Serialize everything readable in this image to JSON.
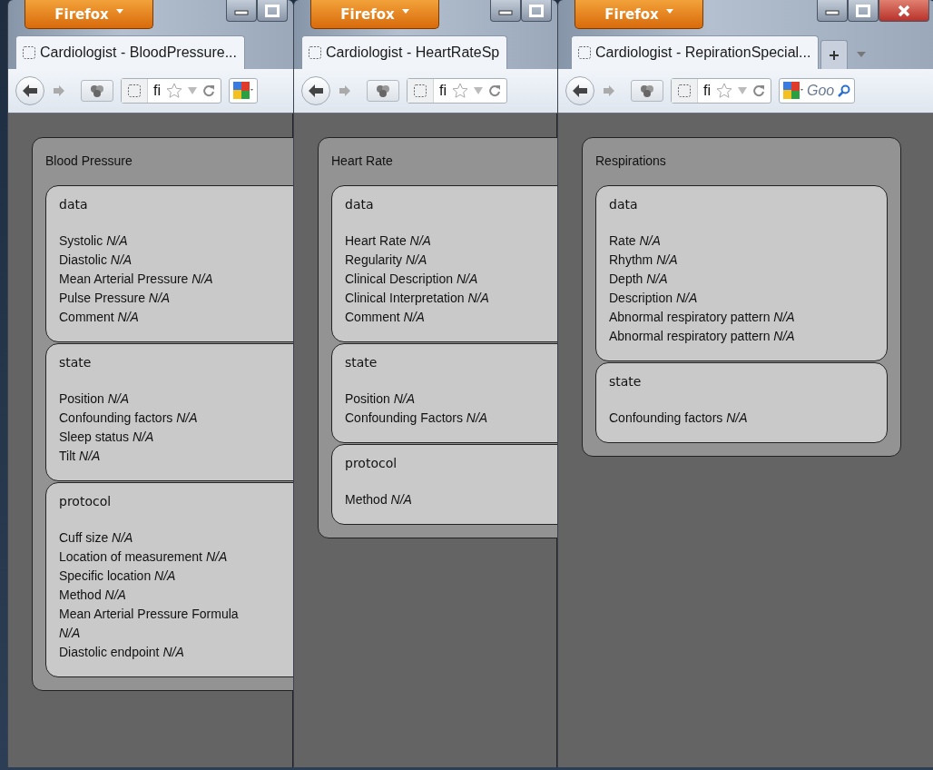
{
  "windows": [
    {
      "app_button": "Firefox",
      "window_buttons": [
        {
          "kind": "minimize"
        },
        {
          "kind": "maximize"
        }
      ],
      "tab_title": "Cardiologist - BloodPressure...",
      "url": "fi",
      "search_box": {
        "kind": "google"
      },
      "panel": {
        "title": "Blood Pressure",
        "sections": [
          {
            "title": "data",
            "fields": [
              {
                "label": "Systolic",
                "value": "N/A"
              },
              {
                "label": "Diastolic",
                "value": "N/A"
              },
              {
                "label": "Mean Arterial Pressure",
                "value": "N/A"
              },
              {
                "label": "Pulse Pressure",
                "value": "N/A"
              },
              {
                "label": "Comment",
                "value": "N/A"
              }
            ]
          },
          {
            "title": "state",
            "fields": [
              {
                "label": "Position",
                "value": "N/A"
              },
              {
                "label": "Confounding factors",
                "value": "N/A"
              },
              {
                "label": "Sleep status",
                "value": "N/A"
              },
              {
                "label": "Tilt",
                "value": "N/A"
              }
            ]
          },
          {
            "title": "protocol",
            "fields": [
              {
                "label": "Cuff size",
                "value": "N/A"
              },
              {
                "label": "Location of measurement",
                "value": "N/A"
              },
              {
                "label": "Specific location",
                "value": "N/A"
              },
              {
                "label": "Method",
                "value": "N/A"
              },
              {
                "label": "Mean Arterial Pressure Formula",
                "value": "N/A"
              },
              {
                "label": "Diastolic endpoint",
                "value": "N/A"
              }
            ]
          }
        ]
      }
    },
    {
      "app_button": "Firefox",
      "window_buttons": [
        {
          "kind": "minimize"
        },
        {
          "kind": "maximize"
        }
      ],
      "tab_title": "Cardiologist - HeartRateSp",
      "url": "fi",
      "panel": {
        "title": "Heart Rate",
        "sections": [
          {
            "title": "data",
            "fields": [
              {
                "label": "Heart Rate",
                "value": "N/A"
              },
              {
                "label": "Regularity",
                "value": "N/A"
              },
              {
                "label": "Clinical Description",
                "value": "N/A"
              },
              {
                "label": "Clinical Interpretation",
                "value": "N/A"
              },
              {
                "label": "Comment",
                "value": "N/A"
              }
            ]
          },
          {
            "title": "state",
            "fields": [
              {
                "label": "Position",
                "value": "N/A"
              },
              {
                "label": "Confounding Factors",
                "value": "N/A"
              }
            ]
          },
          {
            "title": "protocol",
            "fields": [
              {
                "label": "Method",
                "value": "N/A"
              }
            ]
          }
        ]
      }
    },
    {
      "app_button": "Firefox",
      "window_buttons": [
        {
          "kind": "minimize"
        },
        {
          "kind": "maximize"
        },
        {
          "kind": "close"
        }
      ],
      "tab_title": "Cardiologist - RepirationSpecial...",
      "tab_extras": [
        {
          "kind": "new-tab"
        },
        {
          "kind": "tab-list"
        }
      ],
      "url": "fi",
      "search_box": {
        "kind": "google",
        "placeholder": "Goo"
      },
      "panel": {
        "title": "Respirations",
        "sections": [
          {
            "title": "data",
            "fields": [
              {
                "label": "Rate",
                "value": "N/A"
              },
              {
                "label": "Rhythm",
                "value": "N/A"
              },
              {
                "label": "Depth",
                "value": "N/A"
              },
              {
                "label": "Description",
                "value": "N/A"
              },
              {
                "label": "Abnormal respiratory pattern",
                "value": "N/A"
              },
              {
                "label": "Abnormal respiratory pattern",
                "value": "N/A"
              }
            ]
          },
          {
            "title": "state",
            "fields": [
              {
                "label": "Confounding factors",
                "value": "N/A"
              }
            ]
          }
        ]
      }
    }
  ]
}
